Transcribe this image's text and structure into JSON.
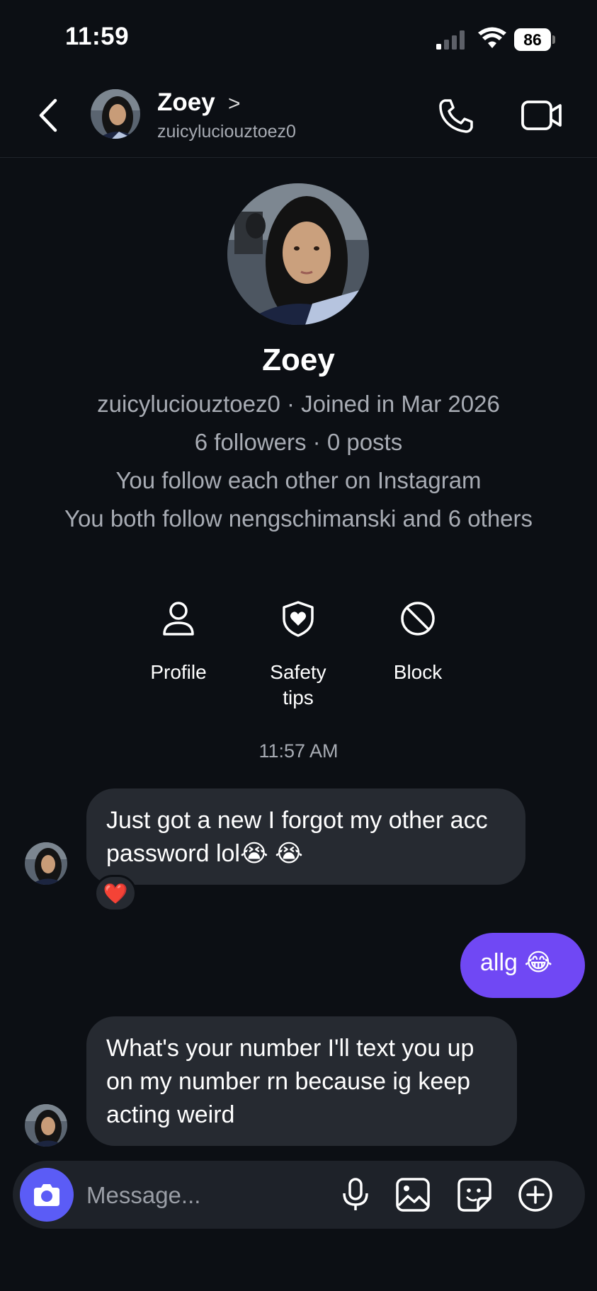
{
  "status_bar": {
    "time": "11:59",
    "battery": "86"
  },
  "header": {
    "name": "Zoey",
    "username": "zuicyluciouztoez0",
    "chevron": ">"
  },
  "profile": {
    "name": "Zoey",
    "line1": "zuicyluciouztoez0 · Joined in Mar 2026",
    "line2": "6 followers · 0 posts",
    "line3": "You follow each other on Instagram",
    "line4": "You both follow nengschimanski and 6 others"
  },
  "actions": [
    {
      "label": "Profile",
      "icon": "person-icon"
    },
    {
      "label": "Safety\ntips",
      "icon": "shield-heart-icon"
    },
    {
      "label": "Block",
      "icon": "block-icon"
    }
  ],
  "timestamp": "11:57 AM",
  "messages": [
    {
      "sender": "them",
      "text": "Just got a new  I forgot my other acc password lol😭 😭",
      "reaction": "❤️"
    },
    {
      "sender": "me",
      "text": "allg 😂"
    },
    {
      "sender": "them",
      "text": "What's your number I'll text you up on my number rn because ig keep acting weird"
    }
  ],
  "composer": {
    "placeholder": "Message..."
  },
  "colors": {
    "background": "#0c0f14",
    "incoming_bubble": "#262a31",
    "outgoing_bubble": "#7048f4",
    "camera_button": "#5b5cf6",
    "secondary_text": "#a8acb4"
  }
}
